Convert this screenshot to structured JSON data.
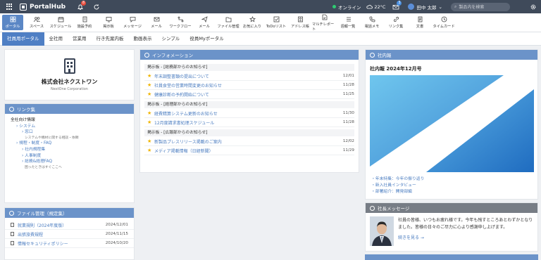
{
  "topbar": {
    "brand": "PortalHub",
    "bell_badge": "8",
    "status": "オンライン",
    "weather": "22°C",
    "mail_badge": "3",
    "user_name": "田中 太郎",
    "search_placeholder": "製品内を検索"
  },
  "iconbar": [
    {
      "label": "ポータル",
      "icon": "grid-icon",
      "active": true
    },
    {
      "label": "スペース",
      "icon": "people-icon"
    },
    {
      "label": "スケジュール",
      "icon": "calendar-icon"
    },
    {
      "label": "施設予約",
      "icon": "building-icon"
    },
    {
      "label": "掲示板",
      "icon": "board-icon"
    },
    {
      "label": "メッセージ",
      "icon": "chat-icon"
    },
    {
      "label": "メール",
      "icon": "mail-icon"
    },
    {
      "label": "ワークフロー",
      "icon": "workflow-icon"
    },
    {
      "label": "メール",
      "icon": "send-icon"
    },
    {
      "label": "ファイル管理",
      "icon": "folder-icon"
    },
    {
      "label": "お気に入り",
      "icon": "star-icon"
    },
    {
      "label": "ToDoリスト",
      "icon": "check-icon"
    },
    {
      "label": "アドレス帳",
      "icon": "address-icon"
    },
    {
      "label": "マルチレポート",
      "icon": "report-icon"
    },
    {
      "label": "週報一覧",
      "icon": "list-icon"
    },
    {
      "label": "電話メモ",
      "icon": "phone-icon"
    },
    {
      "label": "リンク集",
      "icon": "link-icon"
    },
    {
      "label": "文書",
      "icon": "document-icon"
    },
    {
      "label": "タイムカード",
      "icon": "clock-icon"
    }
  ],
  "tabs": [
    "社員用ポータル",
    "全社用",
    "営業用",
    "行き先案内板",
    "動画表示",
    "シンプル",
    "役員Myポータル"
  ],
  "company": {
    "name": "株式会社ネクストワン",
    "en": "NextOne Corporation"
  },
  "links": {
    "title": "リンク集",
    "items": [
      {
        "text": "全社向け情報",
        "level": 1
      },
      {
        "text": "› システム",
        "level": 2
      },
      {
        "text": "› 窓口",
        "level": 3
      },
      {
        "text": "システムや機材に関する相談・依頼",
        "level": 4
      },
      {
        "text": "› 規程・制度・FAQ",
        "level": 2
      },
      {
        "text": "› 社内規程集",
        "level": 3
      },
      {
        "text": "› 人事制度",
        "level": 3
      },
      {
        "text": "› 総務&経理FAQ",
        "level": 3
      },
      {
        "text": "困ったときはすぐここへ",
        "level": 4
      }
    ]
  },
  "files": {
    "title": "ファイル管理（規定集）",
    "items": [
      {
        "name": "就業規則（2024年度版）",
        "date": "2024/12/01"
      },
      {
        "name": "出張旅費規程",
        "date": "2024/11/15"
      },
      {
        "name": "情報セキュリティポリシー",
        "date": "2024/10/20"
      }
    ]
  },
  "info": {
    "title": "インフォメーション",
    "groups": [
      {
        "board": "掲示板 - [総務部からのお知らせ]",
        "items": [
          {
            "text": "年末調整書類の提出について",
            "date": "12/01",
            "star": true
          },
          {
            "text": "社員食堂の営業時間変更のお知らせ",
            "date": "11/28",
            "star": true
          },
          {
            "text": "健康診断の予約開始について",
            "date": "11/25",
            "star": true
          }
        ]
      },
      {
        "board": "掲示板 - [経理部からのお知らせ]",
        "items": [
          {
            "text": "経費精算システム更新のお知らせ",
            "date": "11/30",
            "star": true
          },
          {
            "text": "12月度請求書処理スケジュール",
            "date": "11/28",
            "star": true
          }
        ]
      },
      {
        "board": "掲示板 - [広報部からのお知らせ]",
        "items": [
          {
            "text": "新製品プレスリリース掲載のご案内",
            "date": "12/02",
            "star": true
          },
          {
            "text": "メディア掲載情報（日経新聞）",
            "date": "11/29",
            "star": true
          }
        ]
      }
    ]
  },
  "shanai": {
    "title": "社内報",
    "issue": "社内報 2024年12月号",
    "links": [
      "・年末特集：今年の振り返り",
      "・新入社員インタビュー",
      "・部署紹介：開発部編"
    ]
  },
  "message": {
    "title": "社長メッセージ",
    "text": "社員の皆様、いつもお疲れ様です。今年も残すところあとわずかとなりました。皆様の日々のご尽力に心より感謝申し上げます。",
    "more": "続きを見る →"
  },
  "colors": {
    "topbar": "#3f4a5a",
    "accent": "#6b93c9",
    "link": "#4a7cc0",
    "star": "#f0b400"
  }
}
